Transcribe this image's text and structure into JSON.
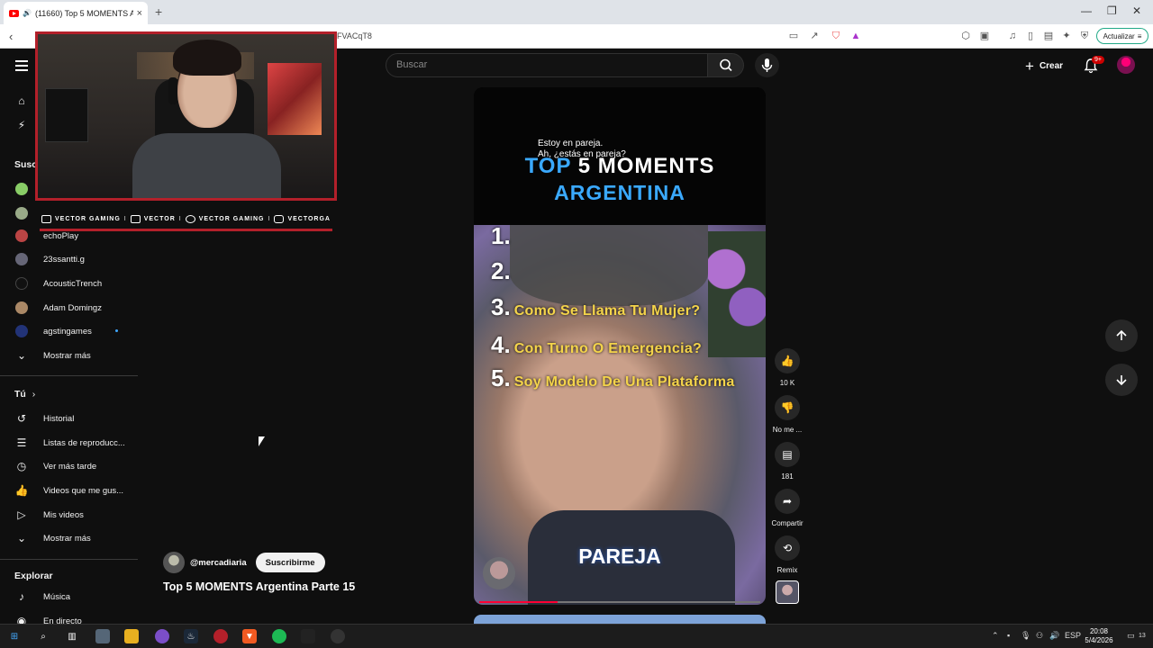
{
  "browser": {
    "tab_title": "(11660) Top 5 MOMENTS Argenti...",
    "tab_close": "×",
    "new_tab": "+",
    "url_fragment": "FVACqT8",
    "update_label": "Actualizar"
  },
  "header": {
    "search_placeholder": "Buscar",
    "create_label": "Crear",
    "notification_badge": "9+"
  },
  "sidebar": {
    "subscriptions_head": "Susc",
    "channels": [
      {
        "label": "echoPlay"
      },
      {
        "label": "23ssantti.g"
      },
      {
        "label": "AcousticTrench"
      },
      {
        "label": "Adam Domingz"
      },
      {
        "label": "agstingames"
      }
    ],
    "show_more_1": "Mostrar más",
    "you_head": "Tú",
    "you_items": [
      {
        "label": "Historial"
      },
      {
        "label": "Listas de reproducc..."
      },
      {
        "label": "Ver más tarde"
      },
      {
        "label": "Videos que me gus..."
      },
      {
        "label": "Mis videos"
      }
    ],
    "show_more_2": "Mostrar más",
    "explore_head": "Explorar",
    "explore_items": [
      {
        "label": "Música"
      },
      {
        "label": "En directo"
      }
    ]
  },
  "overlay": {
    "socials": [
      {
        "label": "VECTOR GAMING"
      },
      {
        "label": "VECTOR"
      },
      {
        "label": "VECTOR GAMING"
      },
      {
        "label": "VECTORGA"
      }
    ],
    "separator": "I"
  },
  "short": {
    "caption_line1": "Estoy en pareja.",
    "caption_line2": "Ah, ¿estás en pareja?",
    "title_top": "TOP",
    "title_rest": "5 MOMENTS",
    "title_line2": "ARGENTINA",
    "ranks": [
      {
        "num": "1.",
        "text": ""
      },
      {
        "num": "2.",
        "text": ""
      },
      {
        "num": "3.",
        "text": "Como Se Llama Tu Mujer?"
      },
      {
        "num": "4.",
        "text": "Con Turno O Emergencia?"
      },
      {
        "num": "5.",
        "text": "Soy Modelo De Una Plataforma"
      }
    ],
    "bottom_caption": "PAREJA",
    "progress": 0.28,
    "channel_handle": "@mercadiaria",
    "subscribe_label": "Suscribirme",
    "video_title": "Top 5 MOMENTS Argentina Parte 15"
  },
  "actions": {
    "likes": "10 K",
    "dislike_label": "No me ...",
    "comments": "181",
    "share_label": "Compartir",
    "remix_label": "Remix"
  },
  "taskbar": {
    "time": "20:08",
    "date": "5/4/2026",
    "lang": "ESP",
    "notif_count": "13"
  }
}
